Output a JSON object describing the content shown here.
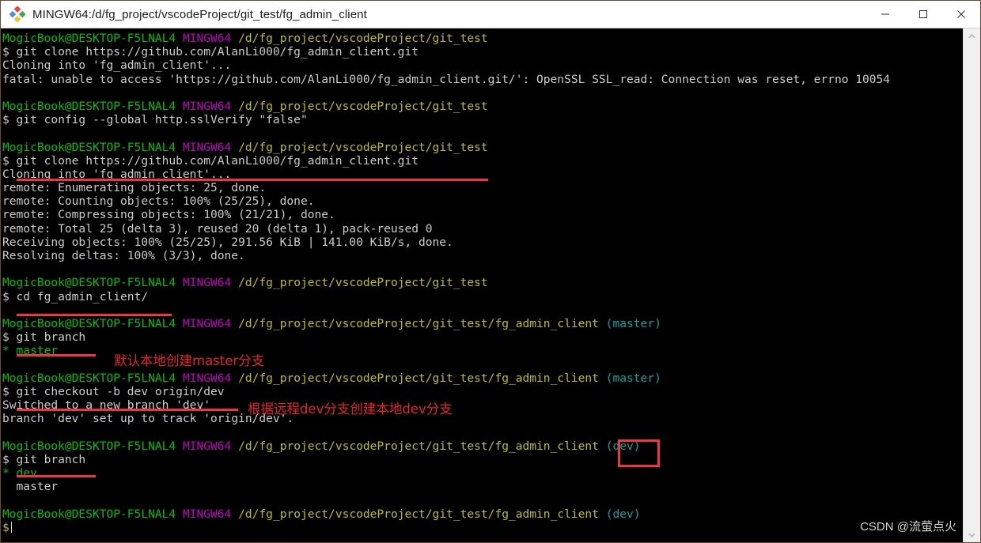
{
  "window": {
    "title": "MINGW64:/d/fg_project/vscodeProject/git_test/fg_admin_client",
    "app_icon": "git-bash-icon",
    "controls": {
      "minimize": "minimize-icon",
      "maximize": "maximize-icon",
      "close": "close-icon"
    }
  },
  "colors": {
    "background": "#000000",
    "user": "#00c000",
    "mingw": "#c000c0",
    "path": "#c0c000",
    "branch": "#00a6a6",
    "text": "#cccccc",
    "annotation": "#e8232f",
    "underline": "#f5333f"
  },
  "terminal": {
    "user_host": "MogicBook@DESKTOP-F5LNAL4",
    "shell": "MINGW64",
    "path_base": "/d/fg_project/vscodeProject/git_test",
    "path_repo": "/d/fg_project/vscodeProject/git_test/fg_admin_client",
    "branch_master": "(master)",
    "branch_dev": "(dev)",
    "prompt_symbol": "$",
    "lines": [
      "$ git clone https://github.com/AlanLi000/fg_admin_client.git",
      "Cloning into 'fg_admin_client'...",
      "fatal: unable to access 'https://github.com/AlanLi000/fg_admin_client.git/': OpenSSL SSL_read: Connection was reset, errno 10054",
      "$ git config --global http.sslVerify \"false\"",
      "remote: Enumerating objects: 25, done.",
      "remote: Counting objects: 100% (25/25), done.",
      "remote: Compressing objects: 100% (21/21), done.",
      "remote: Total 25 (delta 3), reused 20 (delta 1), pack-reused 0",
      "Receiving objects: 100% (25/25), 291.56 KiB | 141.00 KiB/s, done.",
      "Resolving deltas: 100% (3/3), done.",
      "$ cd fg_admin_client/",
      "$ git branch",
      "* master",
      "$ git checkout -b dev origin/dev",
      "Switched to a new branch 'dev'",
      "branch 'dev' set up to track 'origin/dev'.",
      "* dev",
      "  master"
    ],
    "cmd_clone": "$ git clone https://github.com/AlanLi000/fg_admin_client.git",
    "cmd_cloning_into": "Cloning into 'fg_admin_client'...",
    "cmd_fatal": "fatal: unable to access 'https://github.com/AlanLi000/fg_admin_client.git/': OpenSSL SSL_read: Connection was reset, errno 10054",
    "cmd_config": "$ git config --global http.sslVerify \"false\"",
    "out_enumerating": "remote: Enumerating objects: 25, done.",
    "out_counting": "remote: Counting objects: 100% (25/25), done.",
    "out_compressing": "remote: Compressing objects: 100% (21/21), done.",
    "out_total": "remote: Total 25 (delta 3), reused 20 (delta 1), pack-reused 0",
    "out_receiving": "Receiving objects: 100% (25/25), 291.56 KiB | 141.00 KiB/s, done.",
    "out_resolving": "Resolving deltas: 100% (3/3), done.",
    "cmd_cd": "$ cd fg_admin_client/",
    "cmd_branch": "$ git branch",
    "out_star_master": "* master",
    "cmd_checkout": "$ git checkout -b dev origin/dev",
    "out_switched": "Switched to a new branch 'dev'",
    "out_track": "branch 'dev' set up to track 'origin/dev'.",
    "out_star_dev": "* dev",
    "out_master": "  master"
  },
  "annotations": [
    {
      "name": "annotation-master-branch",
      "text": "默认本地创建master分支"
    },
    {
      "name": "annotation-dev-branch",
      "text": "根据远程dev分支创建本地dev分支"
    }
  ],
  "watermark": "CSDN @流萤点火",
  "scrollbar": {
    "up_arrow": "chevron-up-icon",
    "down_arrow": "chevron-down-icon"
  }
}
